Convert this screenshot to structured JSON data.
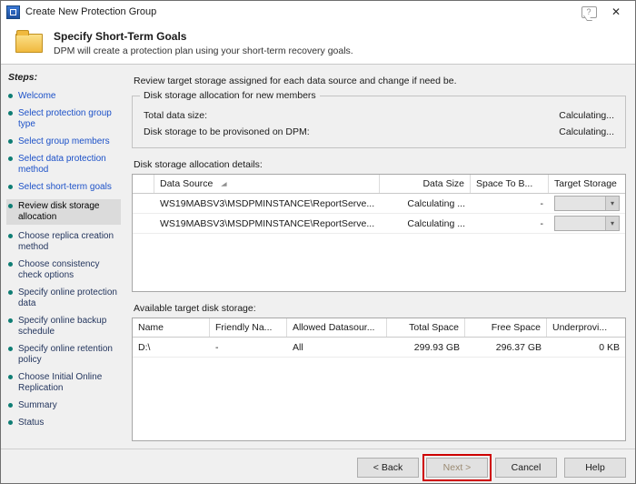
{
  "window": {
    "title": "Create New Protection Group"
  },
  "icons": {
    "help": "?",
    "close": "✕",
    "dropdown": "▾",
    "sort": "◢"
  },
  "header": {
    "title": "Specify Short-Term Goals",
    "subtitle": "DPM will create a protection plan using your short-term recovery goals."
  },
  "sidebar": {
    "title": "Steps:",
    "items": [
      {
        "label": "Welcome",
        "state": "completed"
      },
      {
        "label": "Select protection group type",
        "state": "completed"
      },
      {
        "label": "Select group members",
        "state": "completed"
      },
      {
        "label": "Select data protection method",
        "state": "completed"
      },
      {
        "label": "Select short-term goals",
        "state": "completed"
      },
      {
        "label": "Review disk storage allocation",
        "state": "current"
      },
      {
        "label": "Choose replica creation method",
        "state": "pending"
      },
      {
        "label": "Choose consistency check options",
        "state": "pending"
      },
      {
        "label": "Specify online protection data",
        "state": "pending"
      },
      {
        "label": "Specify online backup schedule",
        "state": "pending"
      },
      {
        "label": "Specify online retention policy",
        "state": "pending"
      },
      {
        "label": "Choose Initial Online Replication",
        "state": "pending"
      },
      {
        "label": "Summary",
        "state": "pending"
      },
      {
        "label": "Status",
        "state": "pending"
      }
    ]
  },
  "main": {
    "instruction": "Review target storage assigned for each data source and change if need be.",
    "allocation_box": {
      "title": "Disk storage allocation for new members",
      "rows": [
        {
          "label": "Total data size:",
          "value": "Calculating..."
        },
        {
          "label": "Disk storage to be provisoned on DPM:",
          "value": "Calculating..."
        }
      ]
    },
    "details_table": {
      "label": "Disk storage allocation details:",
      "columns": {
        "data_source": "Data Source",
        "data_size": "Data Size",
        "space_to_be": "Space To B...",
        "target_storage": "Target Storage"
      },
      "rows": [
        {
          "data_source": "WS19MABSV3\\MSDPMINSTANCE\\ReportServe...",
          "data_size": "Calculating ...",
          "space_to_be": "-"
        },
        {
          "data_source": "WS19MABSV3\\MSDPMINSTANCE\\ReportServe...",
          "data_size": "Calculating ...",
          "space_to_be": "-"
        }
      ]
    },
    "available_table": {
      "label": "Available target disk storage:",
      "columns": {
        "name": "Name",
        "friendly_name": "Friendly Na...",
        "allowed": "Allowed Datasour...",
        "total_space": "Total Space",
        "free_space": "Free Space",
        "underprovisioned": "Underprovi..."
      },
      "rows": [
        {
          "name": "D:\\",
          "friendly_name": "-",
          "allowed": "All",
          "total_space": "299.93 GB",
          "free_space": "296.37 GB",
          "underprovisioned": "0 KB"
        }
      ]
    }
  },
  "footer": {
    "back": "< Back",
    "next": "Next >",
    "cancel": "Cancel",
    "help": "Help"
  },
  "colors": {
    "completed_step": "#1c51c8",
    "pending_step": "#24365e",
    "bullet": "#0e7d74",
    "annotation": "#ce0000"
  }
}
